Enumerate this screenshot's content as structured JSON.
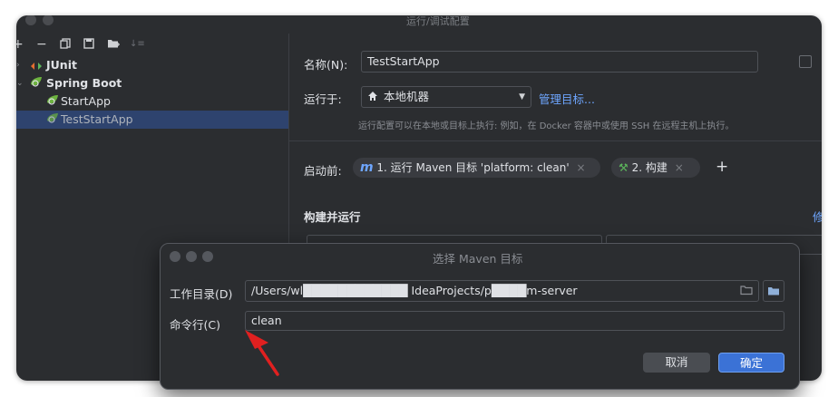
{
  "window": {
    "title": "运行/调试配置"
  },
  "toolbar": {
    "add": "+",
    "remove": "−",
    "sort": "↓≡"
  },
  "tree": {
    "junit": "JUnit",
    "spring_boot": "Spring Boot",
    "start_app": "StartApp",
    "test_start_app": "TestStartApp"
  },
  "form": {
    "name_label": "名称(N):",
    "name_value": "TestStartApp",
    "run_on_label": "运行于:",
    "run_on_value": "本地机器",
    "manage_targets": "管理目标...",
    "hint": "运行配置可以在本地或目标上执行: 例如，在 Docker 容器中或使用 SSH 在远程主机上执行。",
    "before_launch_label": "启动前:",
    "task1": "1. 运行 Maven 目标 'platform: clean'",
    "task2": "2. 构建",
    "add_task": "+",
    "build_run_label": "构建并运行",
    "right_cut_label": "修"
  },
  "dialog": {
    "title": "选择 Maven 目标",
    "workdir_label": "工作目录(D)",
    "workdir_value": "/Users/wl████████████ IdeaProjects/p████m-server",
    "cmd_label": "命令行(C)",
    "cmd_value": "clean",
    "cancel": "取消",
    "ok": "确定"
  },
  "colors": {
    "window_bg": "#2b2d30",
    "selection": "#2e436e",
    "link": "#6ea6ff",
    "primary_button": "#3b72d6",
    "arrow": "#e02020"
  }
}
